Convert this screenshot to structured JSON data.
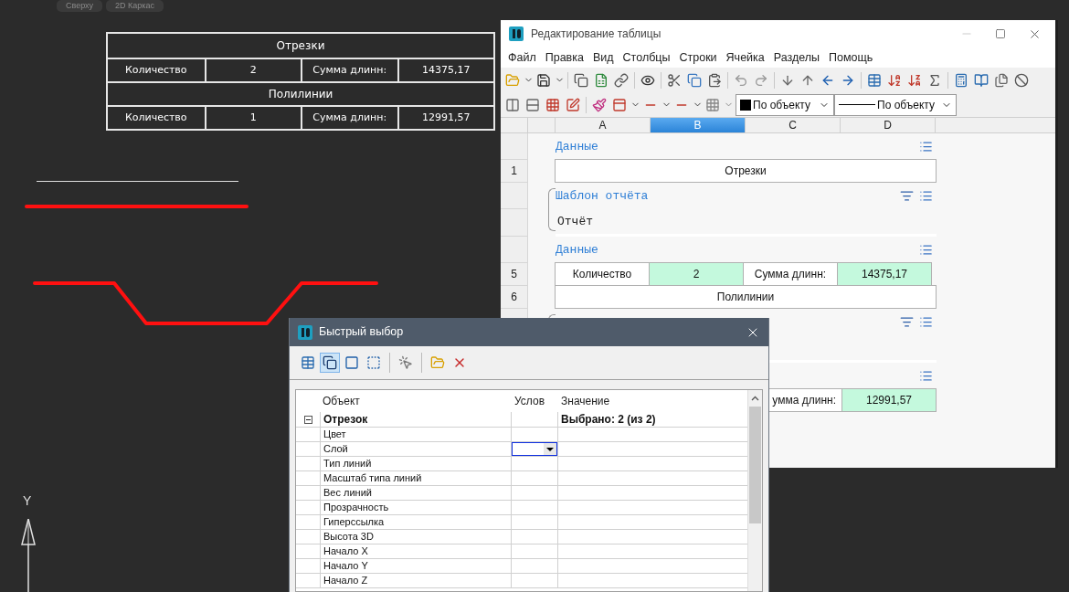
{
  "viewport": {
    "view_labels": [
      "Сверху",
      "2D Каркас"
    ],
    "table": [
      {
        "kind": "title",
        "cells": [
          "Отрезки"
        ]
      },
      {
        "kind": "data",
        "cells": [
          "Количество",
          "2",
          "Сумма длинн:",
          "14375,17"
        ]
      },
      {
        "kind": "title",
        "cells": [
          "Полилинии"
        ]
      },
      {
        "kind": "data",
        "cells": [
          "Количество",
          "1",
          "Сумма длинн:",
          "12991,57"
        ]
      }
    ],
    "axis_label": "Y"
  },
  "table_editor": {
    "title": "Редактирование таблицы",
    "menu": [
      "Файл",
      "Правка",
      "Вид",
      "Столбцы",
      "Строки",
      "Ячейка",
      "Разделы",
      "Помощь"
    ],
    "combos": [
      {
        "kind": "color",
        "value": "По объекту"
      },
      {
        "kind": "linetype",
        "value": "По объекту"
      }
    ],
    "columns": [
      {
        "label": "A",
        "selected": false
      },
      {
        "label": "B",
        "selected": true
      },
      {
        "label": "C",
        "selected": false
      },
      {
        "label": "D",
        "selected": false
      }
    ],
    "sections": [
      {
        "kind": "header",
        "title": "Данные",
        "template": false,
        "filter": false
      },
      {
        "kind": "row",
        "number": "1",
        "cells": [
          {
            "text": "Отрезки",
            "wide": true,
            "computed": false
          }
        ]
      },
      {
        "kind": "header",
        "title": "Шаблон отчёта",
        "template": true,
        "filter": true
      },
      {
        "kind": "text",
        "text": "Отчёт",
        "template": true
      },
      {
        "kind": "header",
        "title": "Данные",
        "template": false,
        "filter": false
      },
      {
        "kind": "row",
        "number": "5",
        "cells": [
          {
            "text": "Количество",
            "wide": false,
            "computed": false
          },
          {
            "text": "2",
            "wide": false,
            "computed": true
          },
          {
            "text": "Сумма длинн:",
            "wide": false,
            "computed": false
          },
          {
            "text": "14375,17",
            "wide": false,
            "computed": true
          }
        ]
      },
      {
        "kind": "row",
        "number": "6",
        "cells": [
          {
            "text": "Полилинии",
            "wide": true,
            "computed": false
          }
        ]
      },
      {
        "kind": "header",
        "template": true,
        "filter": true
      },
      {
        "kind": "text"
      },
      {
        "kind": "header",
        "filter": false
      },
      {
        "kind": "row",
        "cells": [
          {
            "text": "умма длинн:",
            "wide": false,
            "computed": false
          },
          {
            "text": "12991,57",
            "wide": false,
            "computed": true
          }
        ]
      }
    ]
  },
  "quick_select": {
    "title": "Быстрый выбор",
    "tools": [
      {
        "selected": false
      },
      {
        "selected": true
      },
      {
        "selected": false
      },
      {
        "selected": false
      },
      {
        "selected": false
      },
      {
        "selected": false
      },
      {
        "selected": false
      }
    ],
    "columns": [
      "Объект",
      "Услов",
      "Значение"
    ],
    "group": {
      "name": "Отрезок",
      "value": "Выбрано: 2 (из 2)",
      "expanded": true
    },
    "properties": [
      {
        "name": "Цвет",
        "selected": false
      },
      {
        "name": "Слой",
        "selected": true
      },
      {
        "name": "Тип линий",
        "selected": false
      },
      {
        "name": "Масштаб типа линий",
        "selected": false
      },
      {
        "name": "Вес линий",
        "selected": false
      },
      {
        "name": "Прозрачность",
        "selected": false
      },
      {
        "name": "Гиперссылка",
        "selected": false
      },
      {
        "name": "Высота 3D",
        "selected": false
      },
      {
        "name": "Начало X",
        "selected": false
      },
      {
        "name": "Начало Y",
        "selected": false
      },
      {
        "name": "Начало Z",
        "selected": false
      }
    ]
  }
}
